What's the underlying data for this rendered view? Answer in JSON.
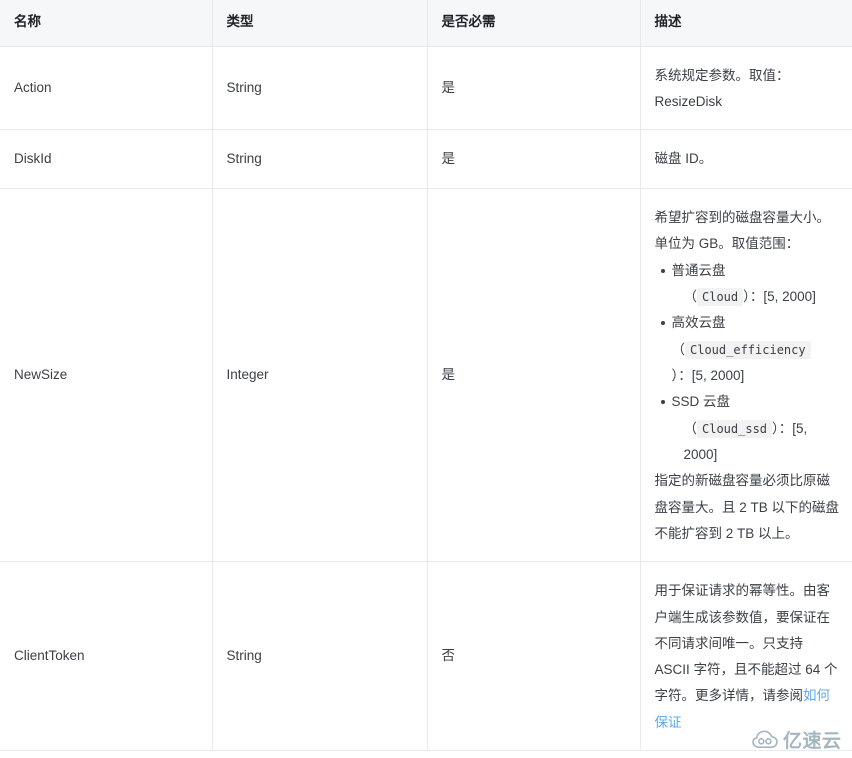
{
  "table": {
    "columns": [
      {
        "key": "name",
        "label": "名称"
      },
      {
        "key": "type",
        "label": "类型"
      },
      {
        "key": "required",
        "label": "是否必需"
      },
      {
        "key": "description",
        "label": "描述"
      }
    ],
    "rows": [
      {
        "name": "Action",
        "type": "String",
        "required": "是",
        "description_text": "系统规定参数。取值：ResizeDisk",
        "description_lines": [
          "系统规定参数。取值：",
          "ResizeDisk"
        ]
      },
      {
        "name": "DiskId",
        "type": "String",
        "required": "是",
        "description_text": "磁盘 ID。",
        "description_lines": [
          "磁盘 ID。"
        ]
      },
      {
        "name": "NewSize",
        "type": "Integer",
        "required": "是",
        "description_intro": "希望扩容到的磁盘容量大小。单位为 GB。取值范围：",
        "description_bullets": [
          {
            "label": "普通云盘",
            "open_paren": "（",
            "code": "Cloud",
            "close_paren": "）",
            "range": "：[5, 2000]"
          },
          {
            "label": "高效云盘",
            "open_paren": "（",
            "code": "Cloud_efficiency",
            "close_paren": "）",
            "range": "：[5, 2000]"
          },
          {
            "label": "SSD 云盘",
            "open_paren": "（",
            "code": "Cloud_ssd",
            "close_paren": "）",
            "range": "：[5, 2000]"
          }
        ],
        "description_note": "指定的新磁盘容量必须比原磁盘容量大。且 2 TB 以下的磁盘不能扩容到 2 TB 以上。"
      },
      {
        "name": "ClientToken",
        "type": "String",
        "required": "否",
        "description_text": "用于保证请求的幂等性。由客户端生成该参数值，要保证在不同请求间唯一。只支持 ASCII 字符，且不能超过 64 个字符。更多详情，请参阅",
        "description_link": "如何保证"
      }
    ]
  },
  "watermark": {
    "text": "亿速云",
    "logo_icon": "cloud-icon",
    "color": "#9fb4bd"
  },
  "colors": {
    "header_background": "#f6f7f8",
    "border": "#e8eaec",
    "text": "#3b4047",
    "header_text": "#1f2329",
    "link": "#5fa8e8",
    "code_background": "#f2f2f3"
  }
}
